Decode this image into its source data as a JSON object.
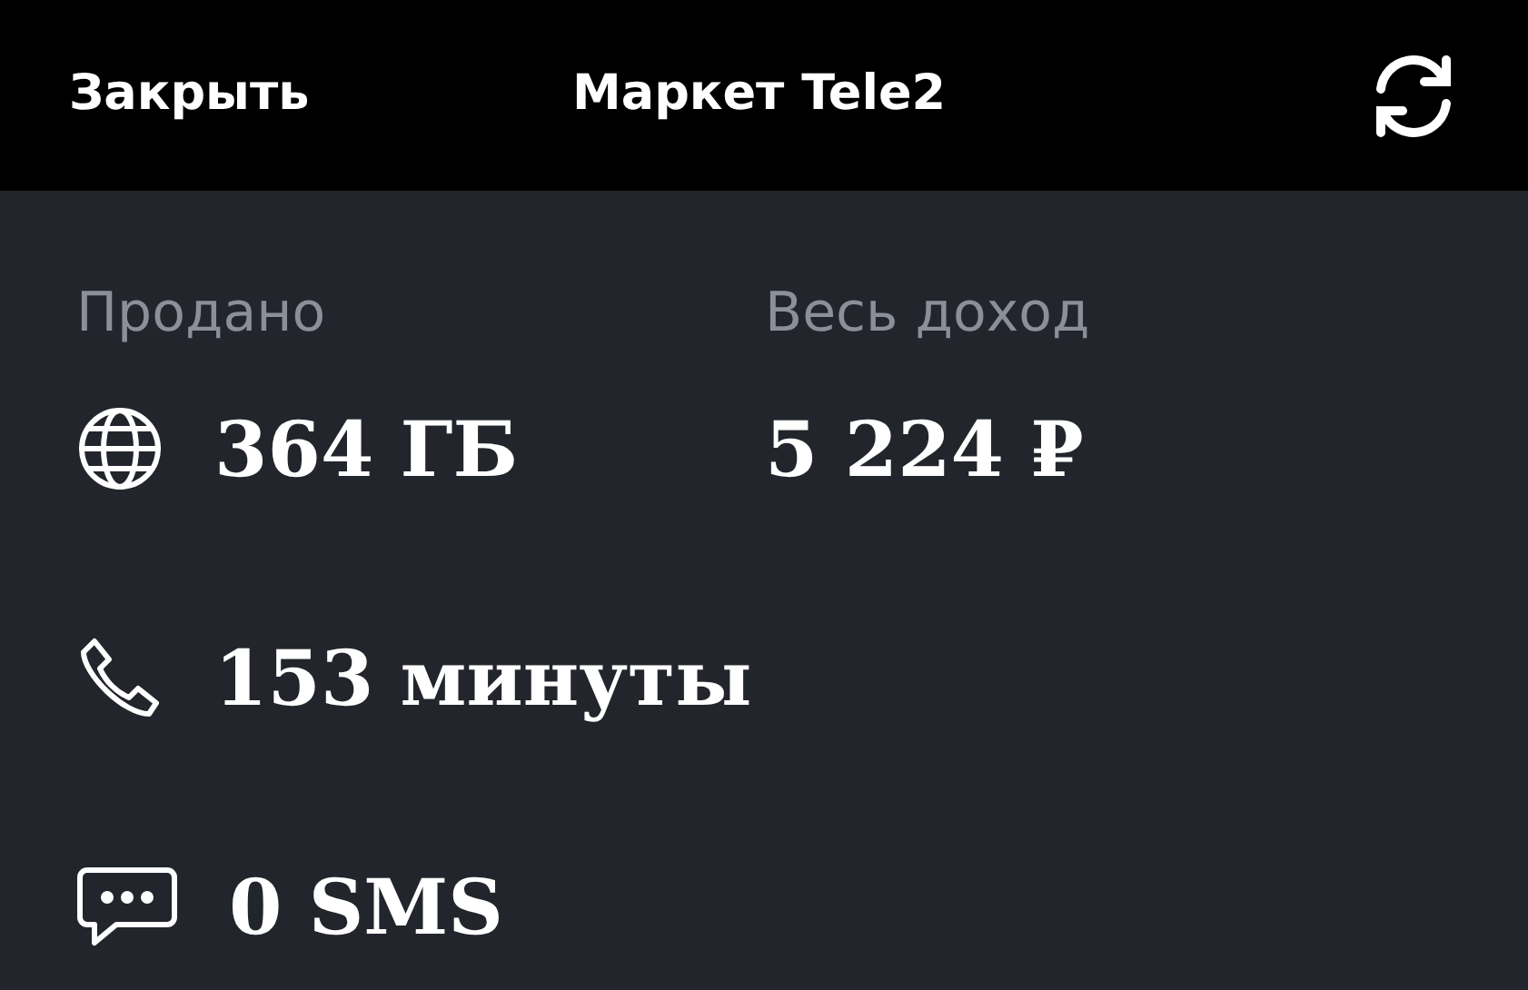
{
  "header": {
    "close": "Закрыть",
    "title": "Маркет Tele2"
  },
  "sold": {
    "label": "Продано",
    "items": [
      {
        "kind": "data",
        "value": "364 ГБ"
      },
      {
        "kind": "calls",
        "value": "153 минуты"
      },
      {
        "kind": "sms",
        "value": "0 SMS"
      }
    ]
  },
  "income": {
    "label": "Весь доход",
    "value": "5 224 ₽"
  }
}
